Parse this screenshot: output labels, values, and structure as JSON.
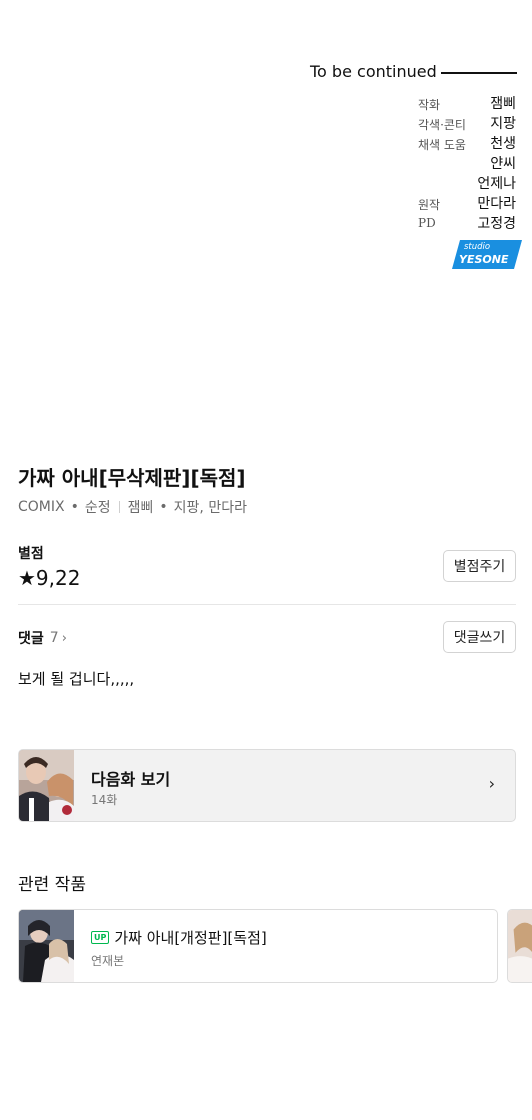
{
  "episode_end": {
    "continued": "To be continued",
    "credits": [
      {
        "role": "작화",
        "name": "잼삐"
      },
      {
        "role": "각색·콘티",
        "name": "지팡"
      },
      {
        "role": "채색 도움",
        "name": "천생"
      },
      {
        "role": "",
        "name": "얀씨"
      },
      {
        "role": "",
        "name": "언제나"
      },
      {
        "role": "원작",
        "name": "만다라"
      },
      {
        "role": "PD",
        "name": "고정경"
      }
    ],
    "logo": {
      "top": "studio",
      "bottom": "YESONE",
      "color": "#1a8fe0"
    }
  },
  "work": {
    "title": "가짜 아내[무삭제판][독점]",
    "category": "COMIX",
    "genre": "순정",
    "authors_main": "잼삐",
    "authors_rest": "지팡, 만다라"
  },
  "rating": {
    "label": "별점",
    "value": "★9,22",
    "button": "별점주기"
  },
  "comments": {
    "label": "댓글",
    "count": "7",
    "chevron": "›",
    "button": "댓글쓰기",
    "top_comment": "보게 될 겁니다,,,,,"
  },
  "next_episode": {
    "title": "다음화 보기",
    "episode": "14화",
    "chevron": "›"
  },
  "related": {
    "heading": "관련 작품",
    "items": [
      {
        "badge": "UP",
        "title": "가짜 아내[개정판][독점]",
        "status": "연재본"
      }
    ]
  },
  "colors": {
    "accent_green": "#00b84f",
    "logo_blue": "#1a8fe0",
    "card_bg": "#f2f2f2"
  }
}
